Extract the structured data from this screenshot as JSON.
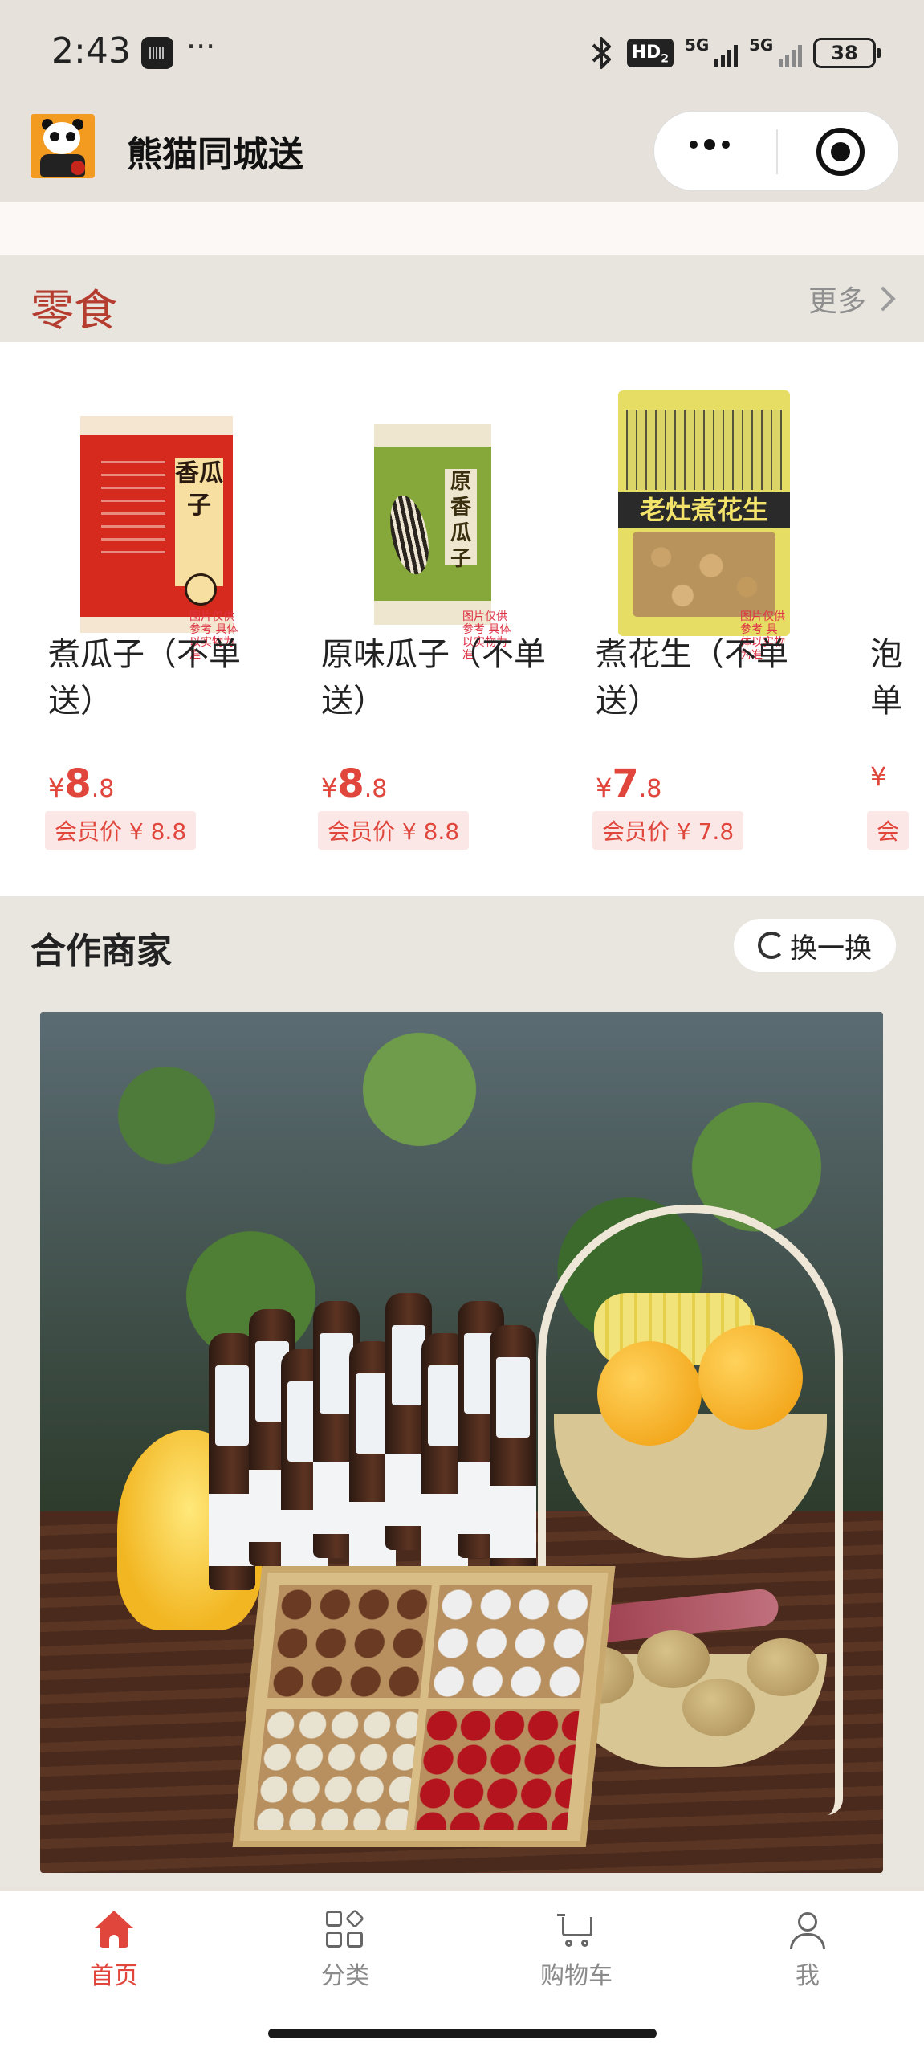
{
  "status_bar": {
    "time": "2:43",
    "dots": "···",
    "hd_label": "HD",
    "hd_sub": "2",
    "signal1": "5G",
    "signal2": "5G",
    "battery": "38"
  },
  "header": {
    "title": "熊猫同城送",
    "more_icon": "more-dots-icon",
    "close_icon": "target-close-icon"
  },
  "snacks": {
    "title": "零食",
    "more_label": "更多",
    "products": [
      {
        "name": "煮瓜子（不单送）",
        "currency": "¥",
        "price_int": "8",
        "price_dec": ".8",
        "member_price": "会员价 ¥ 8.8",
        "pkg_label": "香瓜子"
      },
      {
        "name": "原味瓜子（不单送）",
        "currency": "¥",
        "price_int": "8",
        "price_dec": ".8",
        "member_price": "会员价 ¥ 8.8",
        "pkg_label": "原香瓜子"
      },
      {
        "name": "煮花生（不单送）",
        "currency": "¥",
        "price_int": "7",
        "price_dec": ".8",
        "member_price": "会员价 ¥ 7.8",
        "pkg_label": "老灶煮花生"
      },
      {
        "name": "泡单",
        "currency": "¥",
        "price_int": "",
        "price_dec": "",
        "member_price": "会"
      }
    ],
    "watermark": "图片仅供参考 具体以实物为准"
  },
  "partners": {
    "title": "合作商家",
    "swap_label": "换一换",
    "carousel_total": 3,
    "carousel_active": 3
  },
  "tabbar": {
    "tabs": [
      {
        "label": "首页",
        "icon": "home-icon",
        "active": true
      },
      {
        "label": "分类",
        "icon": "category-grid-icon",
        "active": false
      },
      {
        "label": "购物车",
        "icon": "cart-icon",
        "active": false
      },
      {
        "label": "我",
        "icon": "user-icon",
        "active": false
      }
    ]
  },
  "colors": {
    "accent": "#e0463c",
    "section_title": "#b53d2f",
    "background": "#e8e4dd"
  }
}
